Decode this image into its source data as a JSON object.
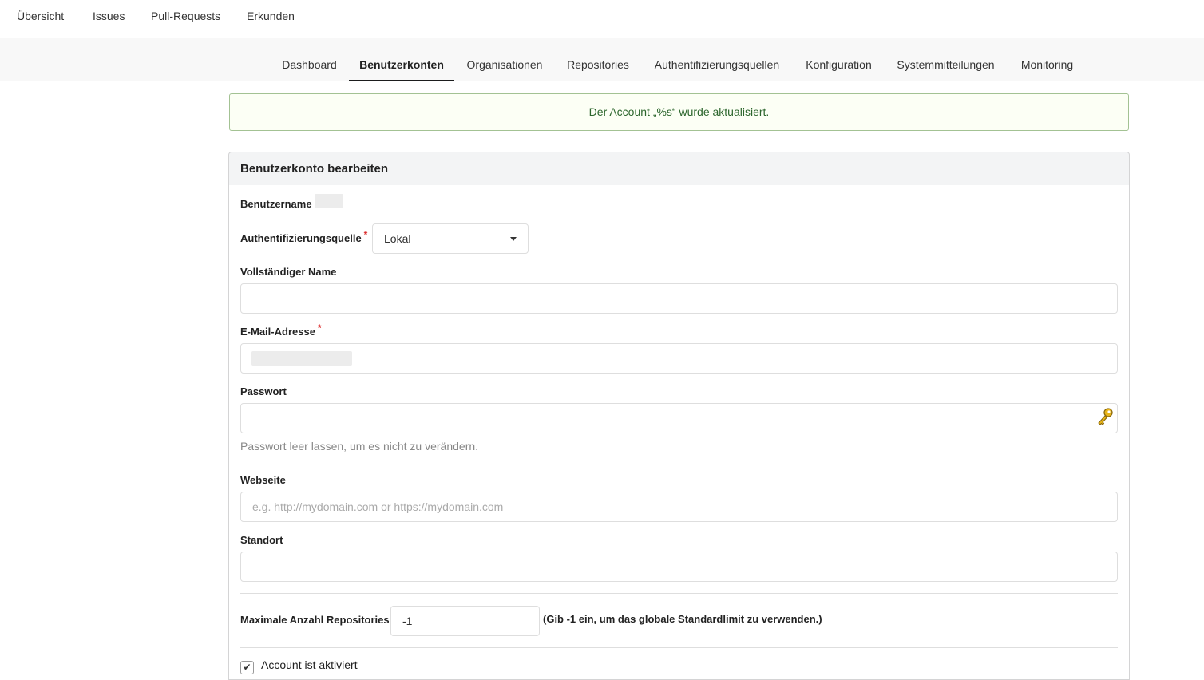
{
  "topnav": {
    "items": [
      "Übersicht",
      "Issues",
      "Pull-Requests",
      "Erkunden"
    ]
  },
  "admin_tabs": {
    "items": [
      "Dashboard",
      "Benutzerkonten",
      "Organisationen",
      "Repositories",
      "Authentifizierungsquellen",
      "Konfiguration",
      "Systemmitteilungen",
      "Monitoring"
    ],
    "active": "Benutzerkonten"
  },
  "flash": {
    "message": "Der Account „%s“ wurde aktualisiert."
  },
  "form": {
    "title": "Benutzerkonto bearbeiten",
    "username_label": "Benutzername",
    "auth_source_label": "Authentifizierungsquelle",
    "auth_source_value": "Lokal",
    "required_mark": "*",
    "full_name_label": "Vollständiger Name",
    "full_name_value": "",
    "email_label": "E-Mail-Adresse",
    "password_label": "Passwort",
    "password_help": "Passwort leer lassen, um es nicht zu verändern.",
    "website_label": "Webseite",
    "website_placeholder": "e.g. http://mydomain.com or https://mydomain.com",
    "location_label": "Standort",
    "location_value": "",
    "max_repos_label": "Maximale Anzahl Repositories",
    "max_repos_value": "-1",
    "max_repos_note": "(Gib -1 ein, um das globale Standardlimit zu verwenden.)",
    "active_label": "Account ist aktiviert",
    "active_checked": true
  },
  "colors": {
    "flash_bg": "#fcfff5",
    "flash_border": "#a3c293",
    "flash_text": "#2c662d",
    "required": "#db2828",
    "active_tab_border": "#1b1c1d"
  },
  "icons": {
    "password_manager": "key-icon",
    "dropdown": "caret-down-icon",
    "checkbox": "check-icon"
  }
}
